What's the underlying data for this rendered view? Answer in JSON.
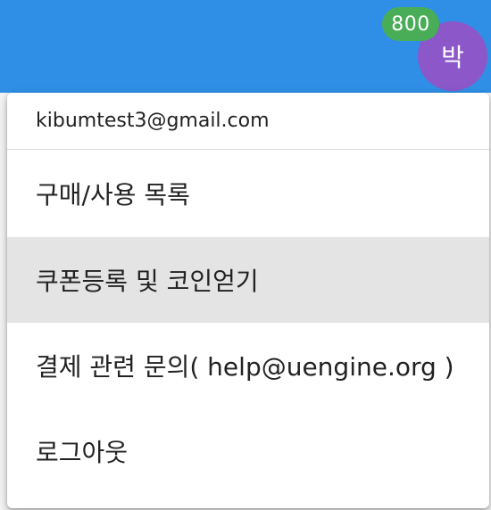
{
  "header": {
    "coin_count": "800",
    "avatar_initial": "박"
  },
  "menu": {
    "email": "kibumtest3@gmail.com",
    "items": [
      {
        "label": "구매/사용 목록"
      },
      {
        "label": "쿠폰등록 및 코인얻기"
      },
      {
        "label": "결제 관련 문의( help@uengine.org )"
      },
      {
        "label": "로그아웃"
      }
    ],
    "highlighted_index": 1
  },
  "colors": {
    "app_bar": "#2f8ee5",
    "avatar": "#8b57c9",
    "badge": "#49ad58",
    "highlight": "#e4e4e4"
  }
}
